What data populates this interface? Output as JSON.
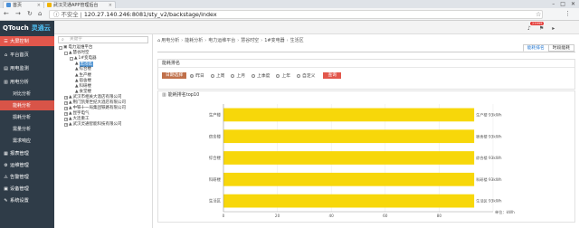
{
  "browser": {
    "tabs": [
      {
        "title": "首页",
        "icon_color": "#4a90d9"
      },
      {
        "title": "武汉灵通APP管理后台",
        "icon_color": "#f0b400"
      }
    ],
    "security_label": "不安全",
    "url": "120.27.140.246:8081/sty_v2/backstage/index"
  },
  "header": {
    "logo_en": "QTouch",
    "logo_cn": "灵通云",
    "badge": "23999",
    "icons": [
      "bell-icon",
      "flag-icon",
      "user-icon"
    ]
  },
  "sidebar": {
    "items": [
      {
        "label": "大屏控制",
        "icon": "☰",
        "active": true
      },
      {
        "label": "平台首页",
        "icon": "⌂"
      },
      {
        "label": "用电监测",
        "icon": "▤"
      },
      {
        "label": "用电分析",
        "icon": "▥"
      },
      {
        "label": "对比分析",
        "icon": "",
        "sub": true
      },
      {
        "label": "能耗分析",
        "icon": "",
        "sub": true,
        "highlight": true
      },
      {
        "label": "损耗分析",
        "icon": "",
        "sub": true
      },
      {
        "label": "需量分析",
        "icon": "",
        "sub": true
      },
      {
        "label": "需求响应",
        "icon": "",
        "sub": true
      },
      {
        "label": "报表管理",
        "icon": "▦"
      },
      {
        "label": "运维管理",
        "icon": "⚙"
      },
      {
        "label": "告警管理",
        "icon": "⚠"
      },
      {
        "label": "设备管理",
        "icon": "▣"
      },
      {
        "label": "系统设置",
        "icon": "✎"
      }
    ]
  },
  "tree": {
    "search_placeholder": "关键字",
    "nodes": [
      {
        "label": "电力运维平台",
        "level": 0,
        "toggle": "-",
        "icon": "▣"
      },
      {
        "label": "慧谷时空",
        "level": 1,
        "toggle": "-",
        "icon": "▲"
      },
      {
        "label": "1#变电器",
        "level": 2,
        "toggle": "-",
        "icon": "▲"
      },
      {
        "label": "生活区",
        "level": 3,
        "toggle": "",
        "icon": "▲",
        "selected": true
      },
      {
        "label": "综合楼",
        "level": 3,
        "toggle": "",
        "icon": "▲"
      },
      {
        "label": "生产楼",
        "level": 3,
        "toggle": "",
        "icon": "▲"
      },
      {
        "label": "宿舍楼",
        "level": 3,
        "toggle": "",
        "icon": "▲"
      },
      {
        "label": "科研楼",
        "level": 3,
        "toggle": "",
        "icon": "▲"
      },
      {
        "label": "食堂楼",
        "level": 3,
        "toggle": "",
        "icon": "▲"
      },
      {
        "label": "武汉市相关大酒店有限公司",
        "level": 1,
        "toggle": "+",
        "icon": "▲"
      },
      {
        "label": "荆门凯莱世纪大酒店有限公司",
        "level": 1,
        "toggle": "+",
        "icon": "▲"
      },
      {
        "label": "中铁十一局集团铁路有限公司",
        "level": 1,
        "toggle": "+",
        "icon": "▲"
      },
      {
        "label": "昆宇电气",
        "level": 1,
        "toggle": "+",
        "icon": "▲"
      },
      {
        "label": "大连重工",
        "level": 1,
        "toggle": "+",
        "icon": "▲"
      },
      {
        "label": "武汉灵通智能科技有限公司",
        "level": 1,
        "toggle": "+",
        "icon": "▲"
      }
    ]
  },
  "content": {
    "breadcrumb": [
      "用电分析",
      "能耗分析",
      "电力运维平台",
      "慧谷时空",
      "1#变电器",
      "生活区"
    ],
    "tabs": [
      "能耗排名",
      "时段能耗"
    ],
    "filter": {
      "title": "能耗排名",
      "date_button": "日期选择",
      "options": [
        "昨日",
        "上周",
        "上月",
        "上季度",
        "上年",
        "自定义"
      ],
      "selected_index": 0,
      "query_button": "查询"
    },
    "chart_title": "能耗排名top10"
  },
  "chart_data": {
    "type": "bar",
    "orientation": "horizontal",
    "title": "能耗排名top10",
    "categories": [
      "生产楼",
      "宿舍楼",
      "综合楼",
      "科研楼",
      "生活区"
    ],
    "values": [
      93,
      93,
      93,
      93,
      93
    ],
    "value_labels": [
      "生产楼 93kWh",
      "宿舍楼 93kWh",
      "综合楼 93kWh",
      "科研楼 93kWh",
      "生活区 93kWh"
    ],
    "xlim": [
      0,
      100
    ],
    "xticks": [
      0,
      20,
      40,
      60,
      80
    ],
    "unit_label": "单位：kWh",
    "bar_color": "#f7d70a",
    "grid": true
  }
}
